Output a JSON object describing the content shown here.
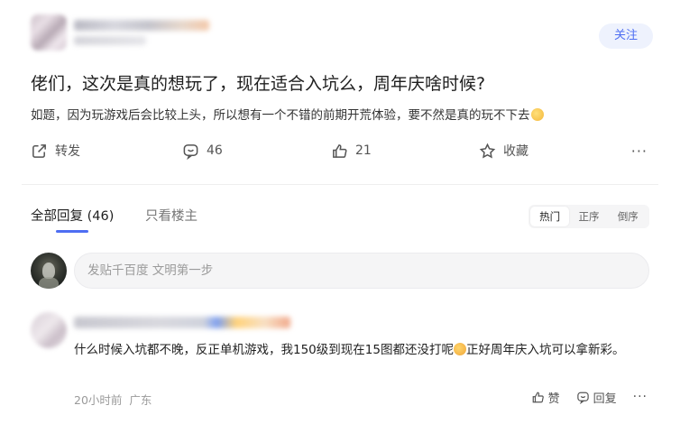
{
  "post": {
    "follow_label": "关注",
    "title": "佬们，这次是真的想玩了，现在适合入坑么，周年庆啥时候?",
    "body": "如题，因为玩游戏后会比较上头，所以想有一个不错的前期开荒体验，要不然是真的玩不下去",
    "actions": {
      "share_label": "转发",
      "comment_count": "46",
      "like_count": "21",
      "favorite_label": "收藏",
      "more_label": "···"
    }
  },
  "tabs": {
    "all_label": "全部回复 (46)",
    "op_only_label": "只看楼主"
  },
  "sort": {
    "options": [
      "热门",
      "正序",
      "倒序"
    ],
    "selected": "热门"
  },
  "reply_box": {
    "placeholder": "发贴千百度 文明第一步"
  },
  "comment": {
    "text_part1": "什么时候入坑都不晚，反正单机游戏，我150级到现在15图都还没打呢",
    "text_part2": "正好周年庆入坑可以拿新彩。",
    "time": "20小时前",
    "location": "广东",
    "like_label": "赞",
    "reply_label": "回复",
    "more_label": "···"
  },
  "icons": {
    "share": "share-icon",
    "comment": "comment-icon",
    "like": "thumbs-up-icon",
    "favorite": "star-icon",
    "more": "more-dots-icon"
  },
  "colors": {
    "accent": "#4e6ef2",
    "follow_bg": "#eef2fd",
    "text_primary": "#1e1e1e",
    "text_muted": "#9a9a9a"
  }
}
